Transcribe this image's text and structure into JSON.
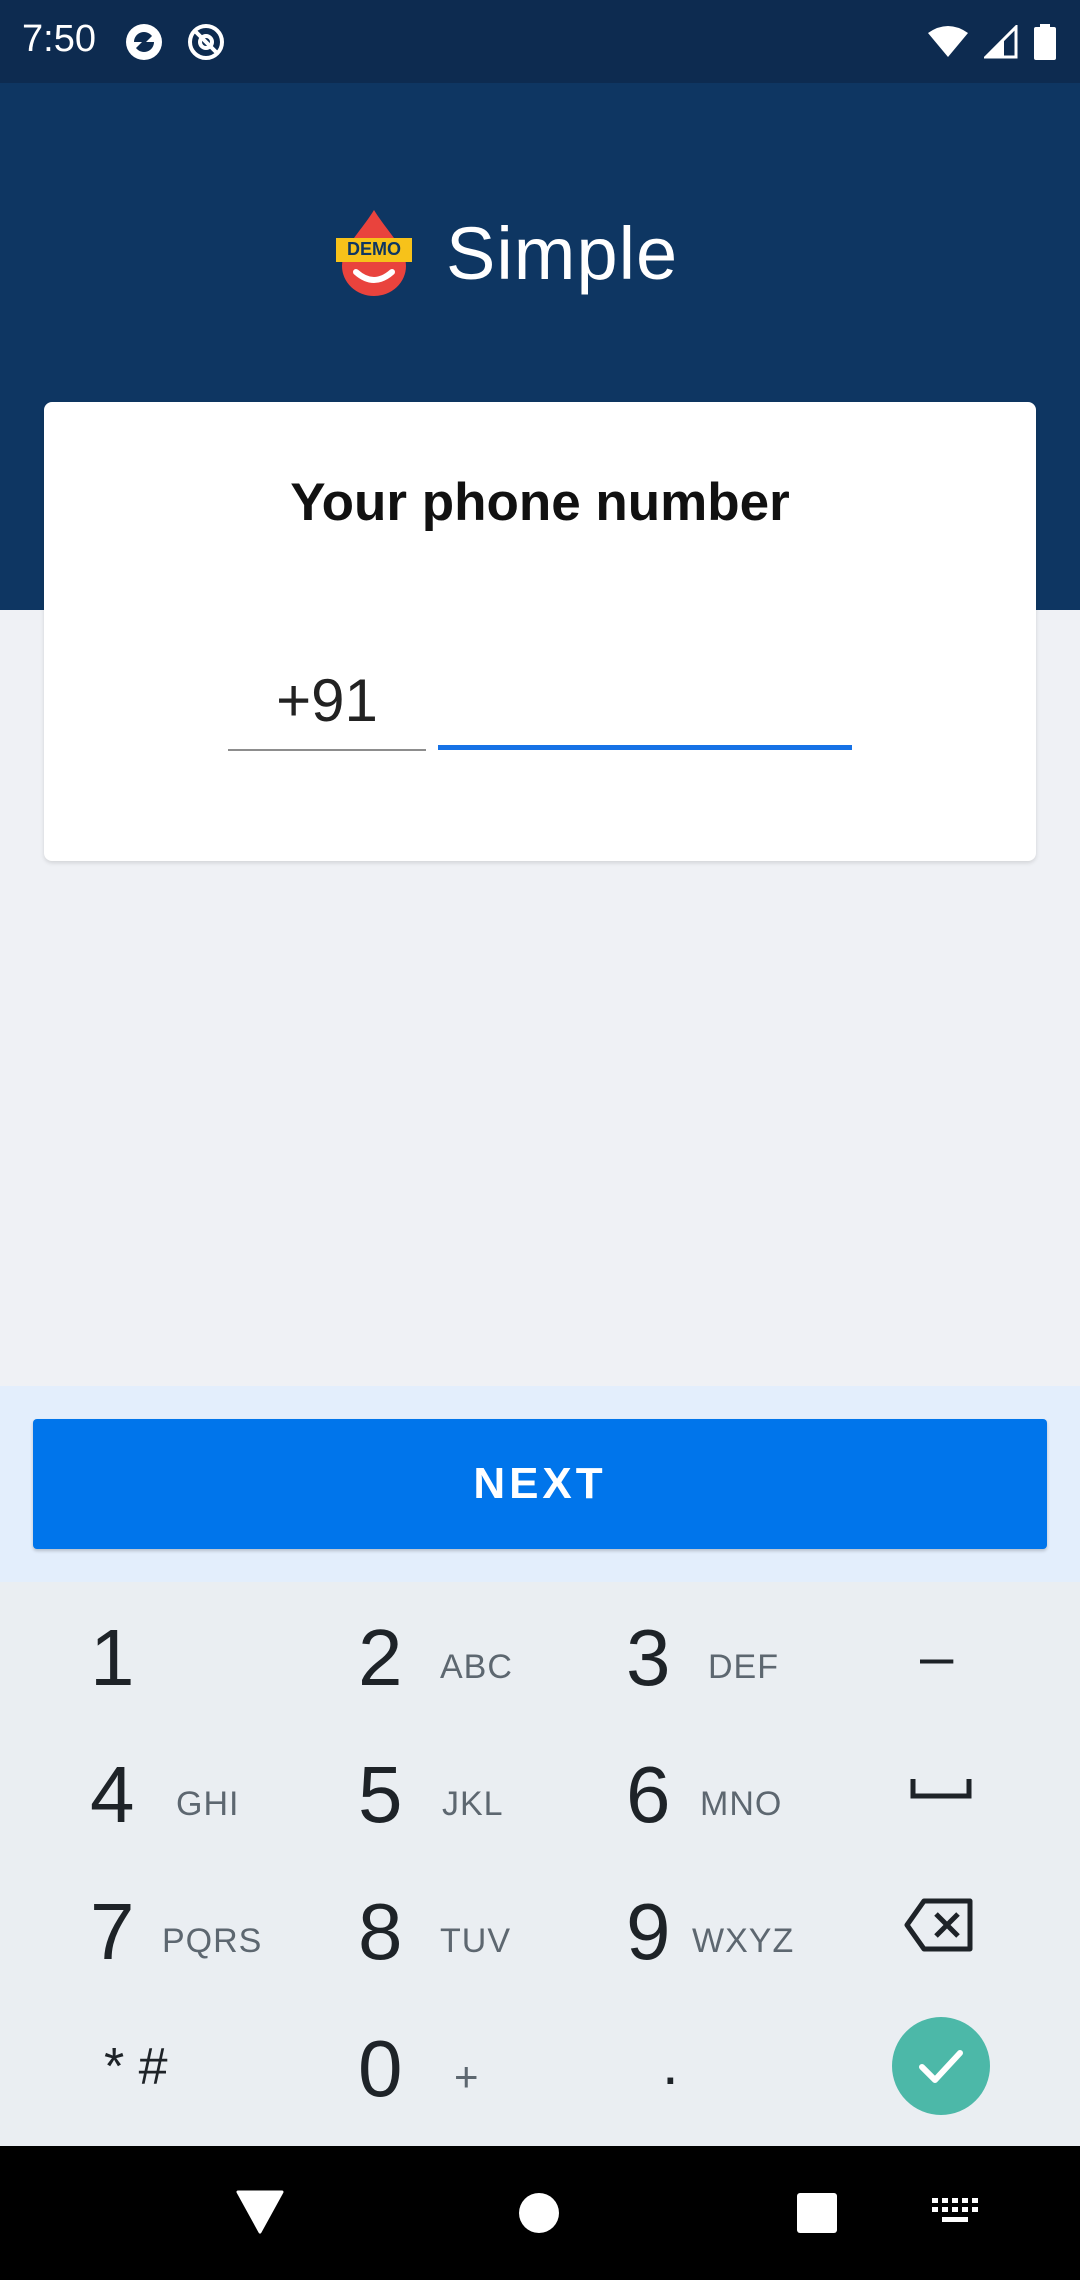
{
  "status_bar": {
    "time": "7:50",
    "icons": [
      "app-notification-icon",
      "at-sign-icon",
      "wifi-icon",
      "signal-icon",
      "battery-icon"
    ]
  },
  "header": {
    "logo_badge": "DEMO",
    "app_name": "Simple",
    "background": "#0e3662"
  },
  "form": {
    "title": "Your phone number",
    "country_code": "+91",
    "phone_value": "",
    "accent": "#1672e6"
  },
  "next_button": {
    "label": "NEXT",
    "color": "#0075eb"
  },
  "keypad": {
    "keys": [
      {
        "digit": "1",
        "letters": ""
      },
      {
        "digit": "2",
        "letters": "ABC"
      },
      {
        "digit": "3",
        "letters": "DEF"
      },
      {
        "digit": "–",
        "letters": ""
      },
      {
        "digit": "4",
        "letters": "GHI"
      },
      {
        "digit": "5",
        "letters": "JKL"
      },
      {
        "digit": "6",
        "letters": "MNO"
      },
      {
        "digit": "space",
        "letters": ""
      },
      {
        "digit": "7",
        "letters": "PQRS"
      },
      {
        "digit": "8",
        "letters": "TUV"
      },
      {
        "digit": "9",
        "letters": "WXYZ"
      },
      {
        "digit": "backspace",
        "letters": ""
      },
      {
        "digit": "* #",
        "letters": ""
      },
      {
        "digit": "0",
        "letters": "+"
      },
      {
        "digit": ".",
        "letters": ""
      },
      {
        "digit": "done",
        "letters": ""
      }
    ],
    "done_color": "#4cb8a8"
  },
  "nav_bar": {
    "icons": [
      "back-icon",
      "home-icon",
      "recents-icon",
      "keyboard-switch-icon"
    ]
  }
}
